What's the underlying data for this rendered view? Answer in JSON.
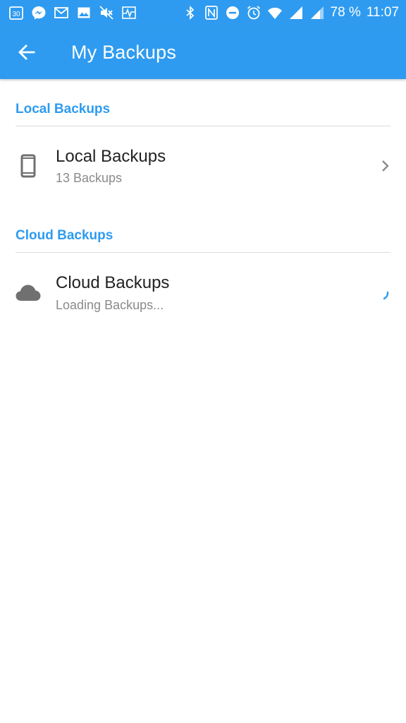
{
  "status_bar": {
    "left_icons": [
      "calendar-icon",
      "messenger-icon",
      "gmail-icon",
      "gallery-icon",
      "mute-icon",
      "activity-icon"
    ],
    "calendar_day": "30",
    "right_icons": [
      "bluetooth-icon",
      "nfc-icon",
      "do-not-disturb-icon",
      "alarm-icon",
      "wifi-icon",
      "cellular-signal-icon",
      "cellular-signal-2-icon"
    ],
    "battery": "78 %",
    "time": "11:07"
  },
  "app_bar": {
    "title": "My Backups",
    "back_icon": "arrow-back-icon",
    "color": "#2e9bf0"
  },
  "sections": {
    "local": {
      "header": "Local Backups",
      "item": {
        "icon": "phone-icon",
        "title": "Local Backups",
        "subtitle": "13 Backups",
        "trailing_icon": "chevron-right-icon"
      }
    },
    "cloud": {
      "header": "Cloud Backups",
      "item": {
        "icon": "cloud-icon",
        "title": "Cloud Backups",
        "subtitle": "Loading Backups...",
        "trailing_icon": "loading-spinner-icon"
      }
    }
  },
  "colors": {
    "accent": "#2e9bf0",
    "text_primary": "#222222",
    "text_secondary": "#8a8a8a",
    "icon_grey": "#707070"
  }
}
